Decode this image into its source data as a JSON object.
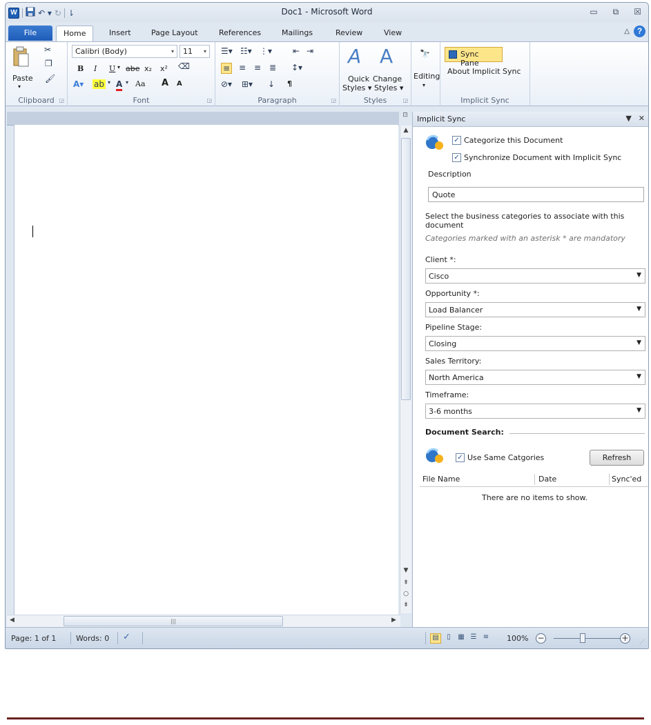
{
  "window": {
    "title": "Doc1 - Microsoft Word"
  },
  "qat": {
    "app_icon": "W",
    "save_icon": "save-icon",
    "undo_icon": "undo-icon",
    "redo_icon": "redo-icon"
  },
  "window_controls": {
    "minimize": "▭",
    "restore": "⧉",
    "close": "☒"
  },
  "tabs": {
    "file": "File",
    "items": [
      "Home",
      "Insert",
      "Page Layout",
      "References",
      "Mailings",
      "Review",
      "View"
    ]
  },
  "ribbon": {
    "clipboard": {
      "paste": "Paste",
      "group_label": "Clipboard"
    },
    "font": {
      "family": "Calibri (Body)",
      "size": "11",
      "bold": "B",
      "italic": "I",
      "underline": "U",
      "strike": "abe",
      "subscript": "x₂",
      "superscript": "x²",
      "change_case": "Aa",
      "grow": "A",
      "shrink": "A",
      "group_label": "Font"
    },
    "paragraph": {
      "pilcrow": "¶",
      "group_label": "Paragraph"
    },
    "styles": {
      "quick_styles": "Quick",
      "quick_styles2": "Styles ▾",
      "change_styles": "Change",
      "change_styles2": "Styles ▾",
      "group_label": "Styles"
    },
    "editing": {
      "label": "Editing"
    },
    "implicit_sync": {
      "sync_pane": "Sync Pane",
      "about": "About Implicit Sync",
      "group_label": "Implicit Sync"
    }
  },
  "pane": {
    "title": "Implicit Sync",
    "categorize_label": "Categorize this Document",
    "synchronize_label": "Synchronize Document with Implicit Sync",
    "description_label": "Description",
    "description_value": "Quote",
    "instructions": "Select the business categories to associate with this document",
    "mandatory_note": "Categories marked with an asterisk * are mandatory",
    "fields": [
      {
        "label": "Client *:",
        "value": "Cisco"
      },
      {
        "label": "Opportunity *:",
        "value": "Load Balancer"
      },
      {
        "label": "Pipeline Stage:",
        "value": "Closing"
      },
      {
        "label": "Sales Territory:",
        "value": "North America"
      },
      {
        "label": "Timeframe:",
        "value": "3-6 months"
      }
    ],
    "search_title": "Document Search:",
    "use_same_label": "Use Same Catgories",
    "refresh_label": "Refresh",
    "columns": [
      "File Name",
      "Date",
      "Sync'ed"
    ],
    "empty_message": "There are no items to show."
  },
  "statusbar": {
    "page": "Page: 1 of 1",
    "words": "Words: 0",
    "zoom": "100%"
  }
}
